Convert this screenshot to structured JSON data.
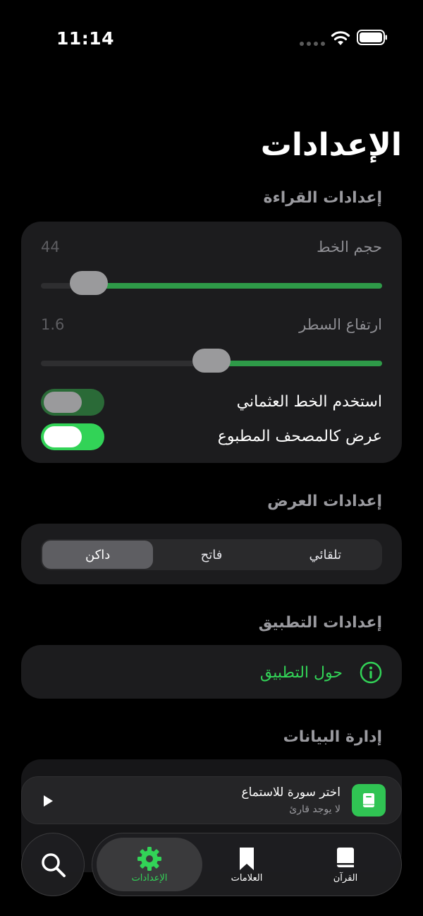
{
  "status": {
    "time": "11:14"
  },
  "page": {
    "title": "الإعدادات"
  },
  "reading": {
    "header": "إعدادات القراءة",
    "font_size": {
      "label": "حجم الخط",
      "value": "44",
      "level": 0.14
    },
    "line_height": {
      "label": "ارتفاع السطر",
      "value": "1.6",
      "level": 0.5
    },
    "uthmani": {
      "label": "استخدم الخط العثماني",
      "on": false
    },
    "mushaf": {
      "label": "عرض كالمصحف المطبوع",
      "on": true
    }
  },
  "display": {
    "header": "إعدادات العرض",
    "options": [
      "تلقائي",
      "فاتح",
      "داكن"
    ],
    "selected": "داكن"
  },
  "app": {
    "header": "إعدادات التطبيق",
    "about_label": "حول التطبيق"
  },
  "data": {
    "header": "إدارة البيانات"
  },
  "player": {
    "title": "اختر سورة للاستماع",
    "subtitle": "لا يوجد قارئ"
  },
  "tabs": [
    {
      "label": "القرآن",
      "icon": "book-icon"
    },
    {
      "label": "العلامات",
      "icon": "bookmark-icon"
    },
    {
      "label": "الإعدادات",
      "icon": "gear-icon",
      "active": true
    }
  ],
  "colors": {
    "accent": "#32d357",
    "slider_fill": "#2e9a48",
    "card": "#1c1c1e"
  }
}
